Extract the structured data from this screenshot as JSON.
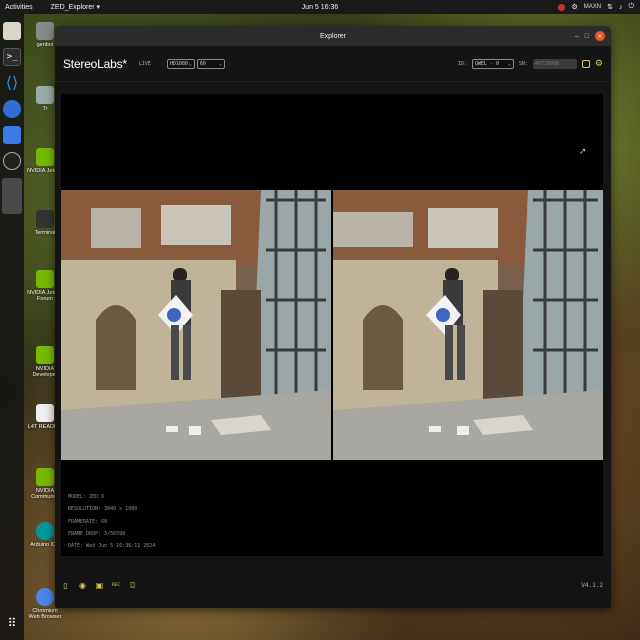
{
  "topbar": {
    "activities": "Activities",
    "app_menu": "ZED_Explorer ▾",
    "clock": "Jun 5  16:36",
    "power_mode": "MAXN"
  },
  "desktop_icons": [
    {
      "label": "genbot"
    },
    {
      "label": "Tr"
    },
    {
      "label": "NVIDIA Jetson"
    },
    {
      "label": "Terminal"
    },
    {
      "label": "NVIDIA Jetson Forum"
    },
    {
      "label": "NVIDIA Developer"
    },
    {
      "label": "L4T README"
    },
    {
      "label": "NVIDIA Community"
    },
    {
      "label": "Arduino IDE"
    },
    {
      "label": "Chromium Web Browser"
    }
  ],
  "window": {
    "title": "Explorer"
  },
  "toolbar": {
    "logo": "StereoLabs*",
    "status": "LIVE",
    "resolution": "HD1080",
    "fps": "60",
    "id_label": "ID:",
    "camera_select": "QWEL - 0",
    "sn_label": "SN:",
    "sn_value": "40729998"
  },
  "info": {
    "model": "MODEL: ZED X",
    "resolution": "RESOLUTION: 3840 x 1080",
    "framerate": "FRAMERATE: 60",
    "frame_drop": "FRAME DROP: 3/56598",
    "date": "DATE: Wed Jun 5 16:36:11 2024"
  },
  "footer": {
    "rec_label": "REC",
    "version": "V4.1.2"
  },
  "colors": {
    "accent": "#d8c85a",
    "close": "#e9541f"
  }
}
